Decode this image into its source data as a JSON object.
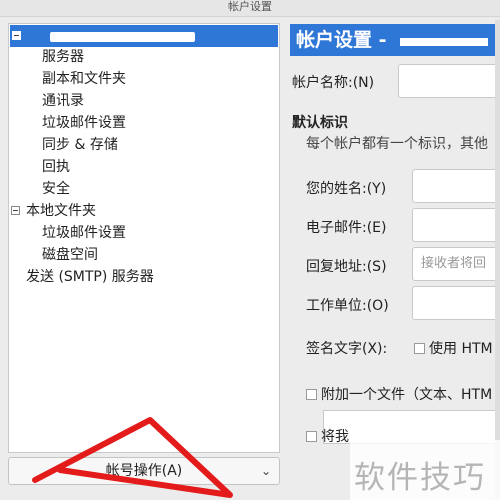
{
  "window": {
    "title": "帐户设置"
  },
  "tree": {
    "account_label": "",
    "account_items": [
      "服务器",
      "副本和文件夹",
      "通讯录",
      "垃圾邮件设置",
      "同步 & 存储",
      "回执",
      "安全"
    ],
    "local_folders": "本地文件夹",
    "local_items": [
      "垃圾邮件设置",
      "磁盘空间"
    ],
    "smtp": "发送 (SMTP) 服务器"
  },
  "account_actions": {
    "label": "帐号操作(A)"
  },
  "header": {
    "title": "帐户设置 -"
  },
  "form": {
    "account_name_label": "帐户名称:(N)",
    "default_identity": "默认标识",
    "identity_hint": "每个帐户都有一个标识，其他",
    "your_name_label": "您的姓名:(Y)",
    "email_label": "电子邮件:(E)",
    "reply_to_label": "回复地址:(S)",
    "reply_to_placeholder": "接收者将回",
    "org_label": "工作单位:(O)",
    "signature_label": "签名文字(X):",
    "use_html_label": "使用 HTM",
    "attach_file_label": "附加一个文件（文本、HTM",
    "partial_label": "将我"
  },
  "colors": {
    "selection": "#2f77d6",
    "annotation": "#e41b1b"
  },
  "watermark": "软件技巧"
}
